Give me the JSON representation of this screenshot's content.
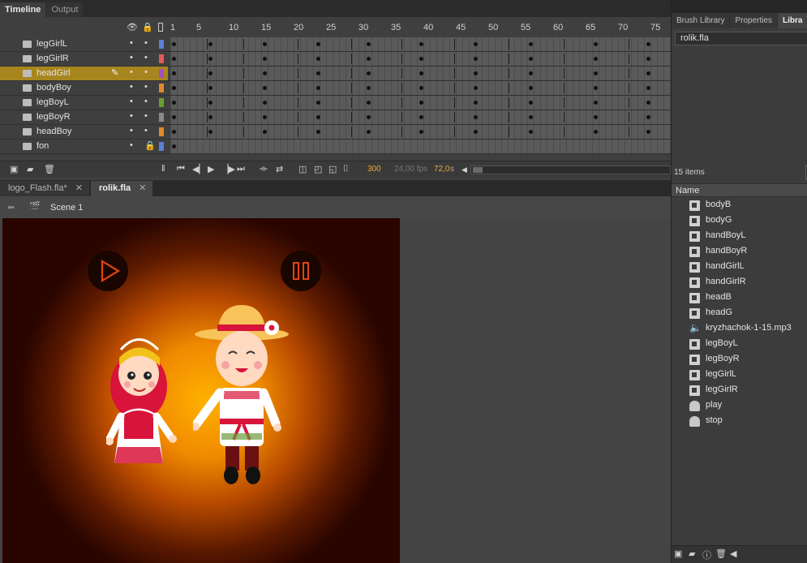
{
  "timeline_tabs": [
    {
      "label": "Timeline"
    },
    {
      "label": "Output"
    }
  ],
  "ruler": [
    "1",
    "5",
    "10",
    "15",
    "20",
    "25",
    "30",
    "35",
    "40",
    "45",
    "50",
    "55",
    "60",
    "65",
    "70",
    "75"
  ],
  "layers": [
    {
      "name": "legGirlL",
      "color": "#5b7fd6",
      "locked": false,
      "selected": false
    },
    {
      "name": "legGirlR",
      "color": "#e35a5a",
      "locked": false,
      "selected": false
    },
    {
      "name": "headGirl",
      "color": "#a64fbf",
      "locked": false,
      "selected": true
    },
    {
      "name": "bodyBoy",
      "color": "#e0892c",
      "locked": false,
      "selected": false
    },
    {
      "name": "legBoyL",
      "color": "#6a9e2f",
      "locked": false,
      "selected": false
    },
    {
      "name": "legBoyR",
      "color": "#8a8a8a",
      "locked": false,
      "selected": false
    },
    {
      "name": "headBoy",
      "color": "#e0892c",
      "locked": false,
      "selected": false
    },
    {
      "name": "fon",
      "color": "#5b7fd6",
      "locked": true,
      "selected": false
    }
  ],
  "playback": {
    "current_frame": "300",
    "fps": "24,00 fps",
    "elapsed": "72,0",
    "elapsed_unit": "s"
  },
  "doc_tabs": [
    {
      "label": "logo_Flash.fla*",
      "active": false
    },
    {
      "label": "rolik.fla",
      "active": true
    }
  ],
  "breadcrumb": {
    "scene": "Scene 1"
  },
  "right_tabs": [
    {
      "label": "Brush Library",
      "active": false
    },
    {
      "label": "Properties",
      "active": false
    },
    {
      "label": "Libra",
      "active": true
    }
  ],
  "library": {
    "document": "rolik.fla",
    "count": "15 items",
    "column": "Name",
    "items": [
      {
        "name": "bodyB",
        "kind": "mc"
      },
      {
        "name": "bodyG",
        "kind": "mc"
      },
      {
        "name": "handBoyL",
        "kind": "mc"
      },
      {
        "name": "handBoyR",
        "kind": "mc"
      },
      {
        "name": "handGirlL",
        "kind": "mc"
      },
      {
        "name": "handGirlR",
        "kind": "mc"
      },
      {
        "name": "headB",
        "kind": "mc"
      },
      {
        "name": "headG",
        "kind": "mc"
      },
      {
        "name": "kryzhachok-1-15.mp3",
        "kind": "snd"
      },
      {
        "name": "legBoyL",
        "kind": "mc"
      },
      {
        "name": "legBoyR",
        "kind": "mc"
      },
      {
        "name": "legGirlL",
        "kind": "mc"
      },
      {
        "name": "legGirlR",
        "kind": "mc"
      },
      {
        "name": "play",
        "kind": "btn"
      },
      {
        "name": "stop",
        "kind": "btn"
      }
    ]
  },
  "colors": {
    "selected_layer": "#a8861f",
    "accent_number": "#e8a93a"
  }
}
